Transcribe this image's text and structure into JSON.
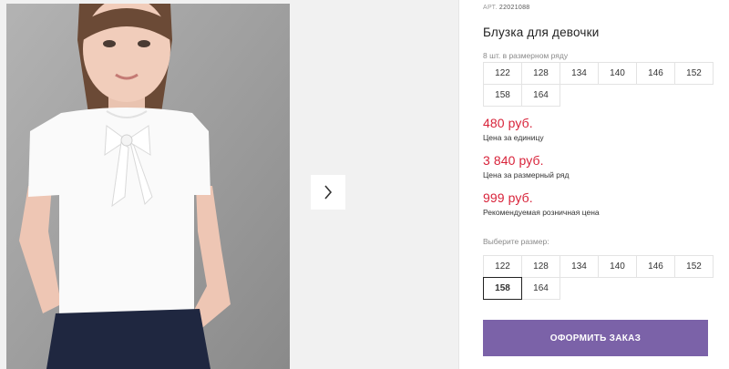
{
  "product": {
    "article_label": "АРТ.",
    "article_value": "22021088",
    "title": "Блузка для девочки",
    "pack_info": "8 шт. в размерном ряду",
    "size_row": [
      "122",
      "128",
      "134",
      "140",
      "146",
      "152",
      "158",
      "164"
    ],
    "prices": [
      {
        "value": "480 руб.",
        "label": "Цена за единицу"
      },
      {
        "value": "3 840 руб.",
        "label": "Цена за размерный ряд"
      },
      {
        "value": "999 руб.",
        "label": "Рекомендуемая розничная цена"
      }
    ],
    "choose_size_label": "Выберите размер:",
    "size_options": [
      "122",
      "128",
      "134",
      "140",
      "146",
      "152",
      "158",
      "164"
    ],
    "selected_size": "158",
    "order_button": "ОФОРМИТЬ ЗАКАЗ"
  },
  "gallery": {
    "next_icon": "chevron-right-icon"
  },
  "colors": {
    "price": "#d8233a",
    "accent_button": "#7b62a8"
  }
}
